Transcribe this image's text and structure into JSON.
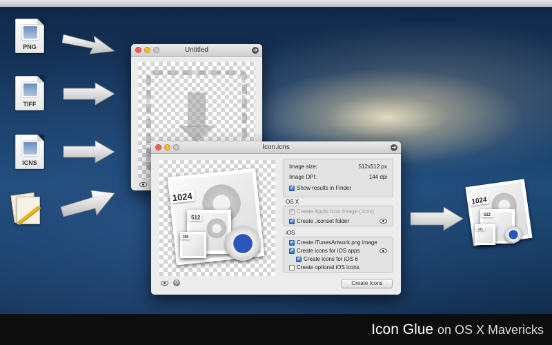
{
  "colors": {
    "caption_bg": "#0e0e0e",
    "window_bg": "#ececec",
    "accent_checkbox": "#2f6bc4",
    "tape_blue": "#2b55b9"
  },
  "input_files": [
    {
      "label": "PNG",
      "icon": "png-file-icon"
    },
    {
      "label": "TIFF",
      "icon": "tiff-file-icon"
    },
    {
      "label": "ICNS",
      "icon": "icns-file-icon"
    }
  ],
  "untitled_window": {
    "title": "Untitled"
  },
  "icon_window": {
    "title": "Icon.icns",
    "preview_labels": {
      "large": "1024",
      "medium": "512",
      "small": "256"
    },
    "info": {
      "image_size_label": "Image size:",
      "image_size_value": "512x512 px",
      "image_dpi_label": "Image DPI:",
      "image_dpi_value": "144 dpi",
      "show_in_finder": "Show results in Finder"
    },
    "osx_section": {
      "title": "OS X",
      "create_apple_icon": "Create Apple Icon Image (.icns)",
      "create_iconset": "Create .iconset folder"
    },
    "ios_section": {
      "title": "iOS",
      "create_itunes": "Create iTunesArtwork.png image",
      "create_ios_apps": "Create icons for iOS apps",
      "create_ios6": "Create icons for iOS 6",
      "create_optional": "Create optional iOS icons"
    },
    "create_button": "Create Icons"
  },
  "output_icon": {
    "labels": {
      "large": "1024",
      "medium": "512",
      "small": "256"
    }
  },
  "caption": {
    "app_name": "Icon Glue",
    "rest": "on OS X Mavericks"
  }
}
